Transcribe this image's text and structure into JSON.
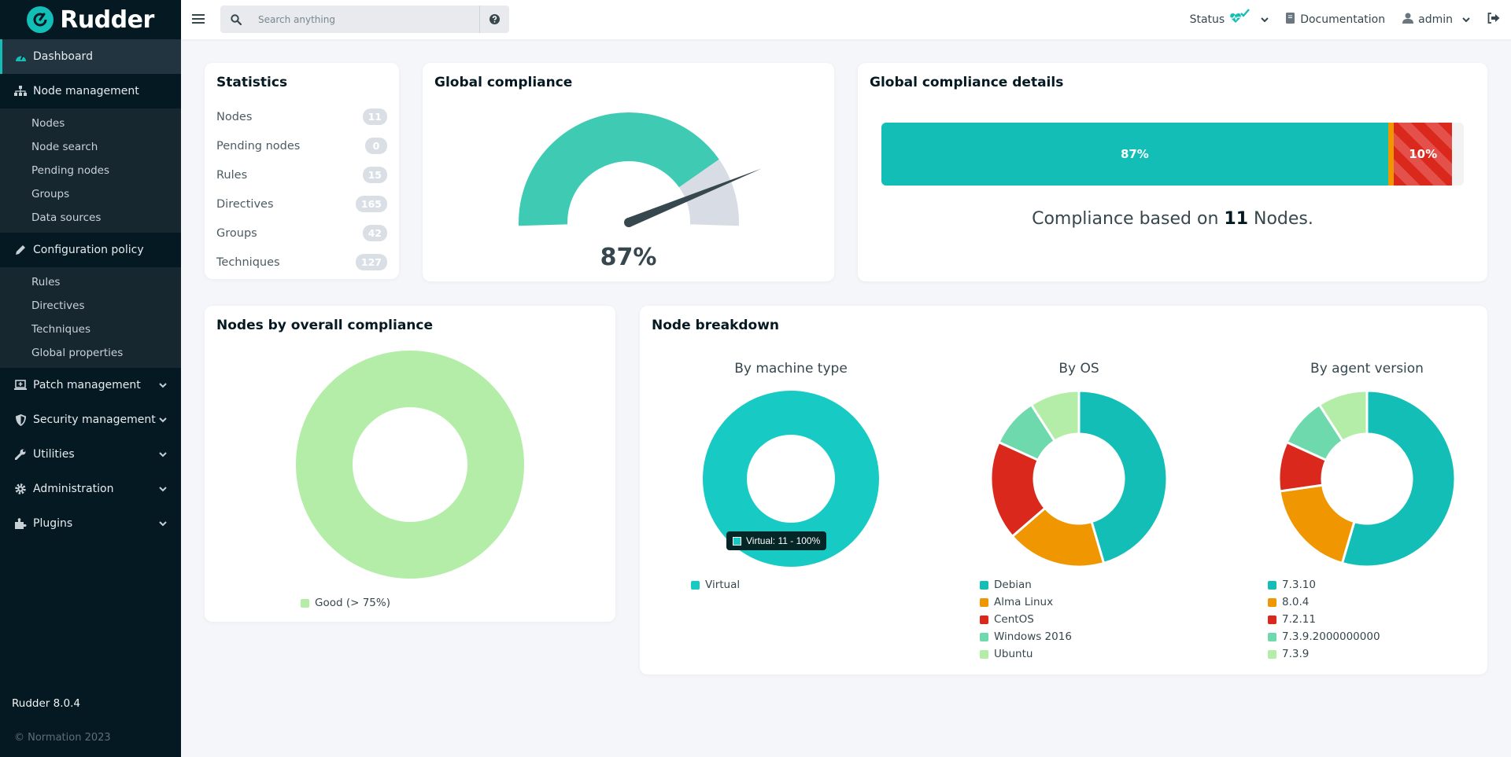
{
  "sidebar": {
    "logo_text": "Rudder",
    "items": [
      {
        "label": "Dashboard",
        "icon": "tachometer-icon",
        "active": true
      },
      {
        "label": "Node management",
        "icon": "sitemap-icon",
        "expanded": true,
        "children": [
          "Nodes",
          "Node search",
          "Pending nodes",
          "Groups",
          "Data sources"
        ]
      },
      {
        "label": "Configuration policy",
        "icon": "pencil-icon",
        "expanded": true,
        "children": [
          "Rules",
          "Directives",
          "Techniques",
          "Global properties"
        ]
      },
      {
        "label": "Patch management",
        "icon": "laptop-icon",
        "expanded": false
      },
      {
        "label": "Security management",
        "icon": "shield-icon",
        "expanded": false
      },
      {
        "label": "Utilities",
        "icon": "wrench-icon",
        "expanded": false
      },
      {
        "label": "Administration",
        "icon": "gear-icon",
        "expanded": false
      },
      {
        "label": "Plugins",
        "icon": "puzzle-icon",
        "expanded": false
      }
    ],
    "version": "Rudder 8.0.4",
    "copyright": "© Normation 2023"
  },
  "topbar": {
    "search_placeholder": "Search anything",
    "status_label": "Status",
    "documentation_label": "Documentation",
    "user_label": "admin"
  },
  "statistics": {
    "title": "Statistics",
    "rows": [
      {
        "label": "Nodes",
        "value": "11"
      },
      {
        "label": "Pending nodes",
        "value": "0"
      },
      {
        "label": "Rules",
        "value": "15"
      },
      {
        "label": "Directives",
        "value": "165"
      },
      {
        "label": "Groups",
        "value": "42"
      },
      {
        "label": "Techniques",
        "value": "127"
      }
    ]
  },
  "global_compliance": {
    "title": "Global compliance",
    "value_label": "87%",
    "value": 87,
    "colors": {
      "good": "#3ecab3",
      "rest": "#d7dce5",
      "needle": "#36474e"
    }
  },
  "compliance_details": {
    "title": "Global compliance details",
    "segments": [
      {
        "name": "success",
        "percent": 87,
        "label": "87%",
        "color": "#13beb7"
      },
      {
        "name": "non-compliant",
        "percent": 1,
        "label": "",
        "color": "#ef9600"
      },
      {
        "name": "error",
        "percent": 10,
        "label": "10%",
        "color": "#da291c",
        "striped": true
      },
      {
        "name": "other",
        "percent": 2,
        "label": "",
        "color": "#f2f2f2"
      }
    ],
    "caption_prefix": "Compliance based on",
    "caption_count": "11",
    "caption_suffix": "Nodes."
  },
  "nodes_by_compliance": {
    "title": "Nodes by overall compliance"
  },
  "node_breakdown": {
    "title": "Node breakdown",
    "tooltip": "Virtual: 11 - 100%"
  },
  "chart_data": [
    {
      "type": "pie",
      "id": "nodes-by-compliance",
      "title": "Nodes by overall compliance",
      "categories": [
        "Good (> 75%)"
      ],
      "values": [
        11
      ],
      "colors": [
        "#b3eda7"
      ],
      "legend": "bottom"
    },
    {
      "type": "pie",
      "id": "by-machine-type",
      "title": "By machine type",
      "categories": [
        "Virtual"
      ],
      "values": [
        11
      ],
      "colors": [
        "#17cbc4"
      ],
      "legend": "bottom"
    },
    {
      "type": "pie",
      "id": "by-os",
      "title": "By OS",
      "categories": [
        "Debian",
        "Alma Linux",
        "CentOS",
        "Windows 2016",
        "Ubuntu"
      ],
      "values": [
        5,
        2,
        2,
        1,
        1
      ],
      "colors": [
        "#13beb7",
        "#ef9600",
        "#da291c",
        "#6fd9ae",
        "#b3eda7"
      ],
      "legend": "bottom"
    },
    {
      "type": "pie",
      "id": "by-agent-version",
      "title": "By agent version",
      "categories": [
        "7.3.10",
        "8.0.4",
        "7.2.11",
        "7.3.9.2000000000",
        "7.3.9"
      ],
      "values": [
        6,
        2,
        1,
        1,
        1
      ],
      "colors": [
        "#13beb7",
        "#ef9600",
        "#da291c",
        "#6fd9ae",
        "#b3eda7"
      ],
      "legend": "bottom"
    }
  ]
}
